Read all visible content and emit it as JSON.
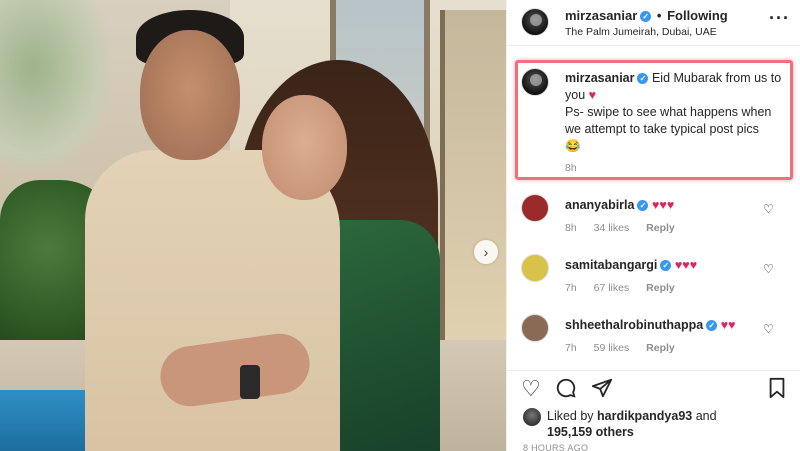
{
  "post": {
    "username": "mirzasaniar",
    "following": "Following",
    "dot": "•",
    "location": "The Palm Jumeirah, Dubai, UAE",
    "more": "···"
  },
  "caption": {
    "username": "mirzasaniar",
    "line1": "Eid Mubarak from us to you",
    "heart": "♥",
    "line2": "Ps- swipe to see what happens when we attempt to take typical post pics",
    "emoji": "😂",
    "time": "8h"
  },
  "comments": [
    {
      "username": "ananyabirla",
      "text": "♥♥♥",
      "time": "8h",
      "likes": "34 likes",
      "reply": "Reply",
      "avatar_color": "#9b2b2b"
    },
    {
      "username": "samitabangargi",
      "text": "♥♥♥",
      "time": "7h",
      "likes": "67 likes",
      "reply": "Reply",
      "avatar_color": "#d7c34a"
    },
    {
      "username": "shheethalrobinuthappa",
      "text": "♥♥",
      "time": "7h",
      "likes": "59 likes",
      "reply": "Reply",
      "avatar_color": "#8a6a55"
    }
  ],
  "likes": {
    "prefix": "Liked by",
    "user": "hardikpandya93",
    "and": "and",
    "count": "195,159 others"
  },
  "time_ago": "8 HOURS AGO",
  "icons": {
    "like": "heart-outline",
    "comment": "comment-bubble",
    "share": "paper-plane",
    "save": "bookmark",
    "next": "chevron-right"
  }
}
